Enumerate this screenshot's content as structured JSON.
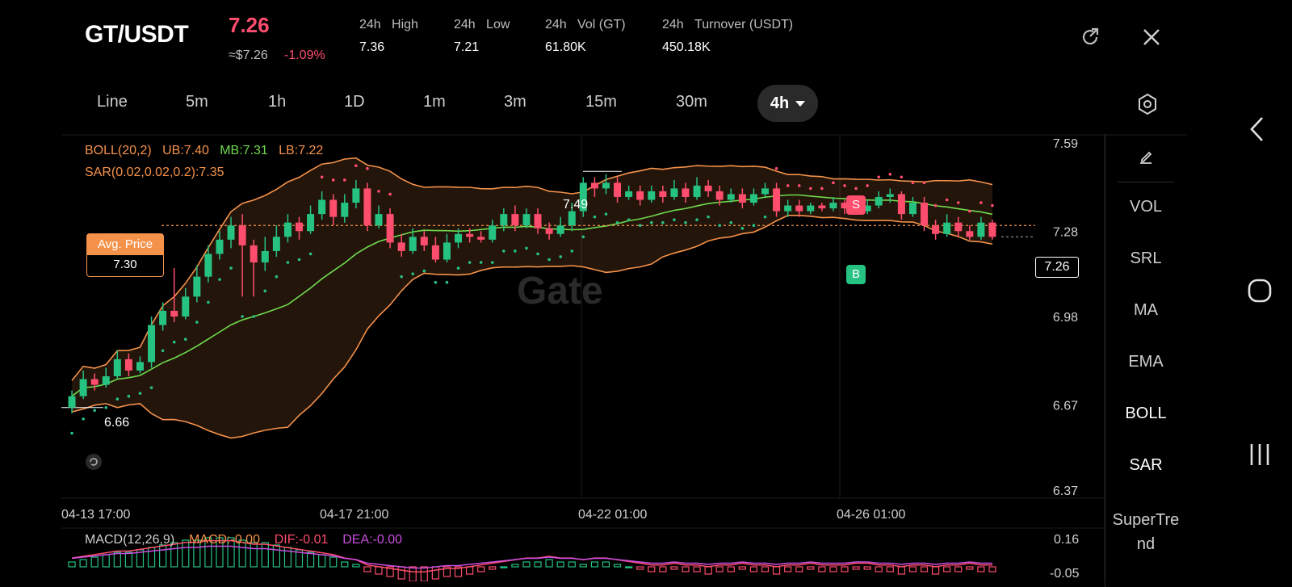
{
  "header": {
    "pair": "GT/USDT",
    "price": "7.26",
    "approx": "≈$7.26",
    "change": "-1.09%",
    "stats": [
      {
        "period": "24h",
        "label": "High",
        "value": "7.36"
      },
      {
        "period": "24h",
        "label": "Low",
        "value": "7.21"
      },
      {
        "period": "24h",
        "label": "Vol (GT)",
        "value": "61.80K"
      },
      {
        "period": "24h",
        "label": "Turnover (USDT)",
        "value": "450.18K"
      }
    ],
    "icons": [
      "share-icon",
      "close-icon"
    ]
  },
  "timeframes": [
    "Line",
    "5m",
    "1h",
    "1D",
    "1m",
    "3m",
    "15m",
    "30m"
  ],
  "active_timeframe": "4h",
  "settings_icon": "settings-hex-icon",
  "legend": {
    "boll_name": "BOLL(20,2)",
    "boll_ub": "UB:7.40",
    "boll_mb": "MB:7.31",
    "boll_lb": "LB:7.22",
    "sar": "SAR(0.02,0.02,0.2):7.35"
  },
  "avg_price": {
    "label": "Avg. Price",
    "value": "7.30"
  },
  "markers": {
    "sell": "S",
    "buy": "B",
    "high_label": "7.49",
    "low_label": "6.66",
    "last_price": "7.26",
    "hidden_axis_label": "7.28"
  },
  "watermark": "Gate",
  "side_panel": {
    "edit_icon": "pencil-icon",
    "items": [
      "VOL",
      "SRL",
      "MA",
      "EMA",
      "BOLL",
      "SAR",
      "SuperTre",
      "nd"
    ]
  },
  "nav_icons": [
    "back-icon",
    "home-icon",
    "recents-icon"
  ],
  "macd": {
    "name": "MACD(12,26,9)",
    "macd": "MACD:-0.00",
    "dif": "DIF:-0.01",
    "dea": "DEA:-0.00",
    "axis_top": "0.16",
    "axis_bottom": "-0.05"
  },
  "colors": {
    "up": "#26c281",
    "down": "#ff4d6d",
    "boll_band": "#f5924a",
    "mb": "#6fdb4e",
    "sar": "#ff4d6d",
    "dif": "#ff4d6d",
    "dea": "#c94fe0"
  },
  "chart_data": {
    "type": "candlestick",
    "y_ticks": [
      "7.59",
      "6.98",
      "6.67",
      "6.37"
    ],
    "x_ticks": [
      "04-13 17:00",
      "04-17 21:00",
      "04-22 01:00",
      "04-26 01:00"
    ],
    "ylim": [
      6.37,
      7.59
    ],
    "avg_price": 7.3,
    "grid": true,
    "candles": [
      [
        6.66,
        6.7,
        6.64,
        6.72
      ],
      [
        6.7,
        6.76,
        6.69,
        6.79
      ],
      [
        6.76,
        6.74,
        6.72,
        6.78
      ],
      [
        6.74,
        6.77,
        6.73,
        6.8
      ],
      [
        6.77,
        6.83,
        6.76,
        6.86
      ],
      [
        6.83,
        6.79,
        6.77,
        6.85
      ],
      [
        6.79,
        6.82,
        6.78,
        6.84
      ],
      [
        6.82,
        6.95,
        6.8,
        6.98
      ],
      [
        6.95,
        7.0,
        6.93,
        7.03
      ],
      [
        7.0,
        6.98,
        6.96,
        7.15
      ],
      [
        6.98,
        7.05,
        6.97,
        7.08
      ],
      [
        7.05,
        7.12,
        7.03,
        7.16
      ],
      [
        7.12,
        7.2,
        7.1,
        7.23
      ],
      [
        7.2,
        7.25,
        7.18,
        7.28
      ],
      [
        7.25,
        7.3,
        7.22,
        7.33
      ],
      [
        7.3,
        7.23,
        7.05,
        7.34
      ],
      [
        7.23,
        7.17,
        7.05,
        7.25
      ],
      [
        7.17,
        7.21,
        7.14,
        7.26
      ],
      [
        7.21,
        7.26,
        7.19,
        7.3
      ],
      [
        7.26,
        7.31,
        7.24,
        7.34
      ],
      [
        7.31,
        7.28,
        7.25,
        7.33
      ],
      [
        7.28,
        7.34,
        7.27,
        7.37
      ],
      [
        7.34,
        7.39,
        7.32,
        7.42
      ],
      [
        7.39,
        7.33,
        7.3,
        7.41
      ],
      [
        7.33,
        7.38,
        7.31,
        7.41
      ],
      [
        7.38,
        7.43,
        7.36,
        7.46
      ],
      [
        7.43,
        7.3,
        7.28,
        7.45
      ],
      [
        7.3,
        7.34,
        7.29,
        7.37
      ],
      [
        7.34,
        7.24,
        7.22,
        7.36
      ],
      [
        7.24,
        7.21,
        7.19,
        7.27
      ],
      [
        7.21,
        7.26,
        7.2,
        7.29
      ],
      [
        7.26,
        7.23,
        7.21,
        7.28
      ],
      [
        7.23,
        7.18,
        7.17,
        7.26
      ],
      [
        7.18,
        7.24,
        7.17,
        7.27
      ],
      [
        7.24,
        7.27,
        7.22,
        7.29
      ],
      [
        7.27,
        7.26,
        7.24,
        7.29
      ],
      [
        7.26,
        7.25,
        7.24,
        7.28
      ],
      [
        7.25,
        7.3,
        7.24,
        7.32
      ],
      [
        7.3,
        7.34,
        7.28,
        7.36
      ],
      [
        7.34,
        7.3,
        7.28,
        7.37
      ],
      [
        7.3,
        7.34,
        7.29,
        7.36
      ],
      [
        7.34,
        7.29,
        7.27,
        7.36
      ],
      [
        7.29,
        7.27,
        7.25,
        7.31
      ],
      [
        7.27,
        7.3,
        7.26,
        7.33
      ],
      [
        7.3,
        7.35,
        7.28,
        7.38
      ],
      [
        7.35,
        7.45,
        7.33,
        7.47
      ],
      [
        7.45,
        7.43,
        7.4,
        7.47
      ],
      [
        7.43,
        7.45,
        7.41,
        7.48
      ],
      [
        7.45,
        7.4,
        7.38,
        7.47
      ],
      [
        7.4,
        7.42,
        7.39,
        7.44
      ],
      [
        7.42,
        7.39,
        7.37,
        7.44
      ],
      [
        7.39,
        7.42,
        7.38,
        7.44
      ],
      [
        7.42,
        7.4,
        7.38,
        7.44
      ],
      [
        7.4,
        7.43,
        7.39,
        7.46
      ],
      [
        7.43,
        7.4,
        7.38,
        7.45
      ],
      [
        7.4,
        7.44,
        7.39,
        7.47
      ],
      [
        7.44,
        7.42,
        7.4,
        7.46
      ],
      [
        7.42,
        7.39,
        7.37,
        7.44
      ],
      [
        7.39,
        7.41,
        7.38,
        7.43
      ],
      [
        7.41,
        7.38,
        7.36,
        7.43
      ],
      [
        7.38,
        7.41,
        7.37,
        7.43
      ],
      [
        7.41,
        7.43,
        7.4,
        7.45
      ],
      [
        7.43,
        7.35,
        7.33,
        7.45
      ],
      [
        7.35,
        7.37,
        7.33,
        7.39
      ],
      [
        7.37,
        7.35,
        7.33,
        7.39
      ],
      [
        7.35,
        7.37,
        7.34,
        7.38
      ],
      [
        7.37,
        7.36,
        7.35,
        7.38
      ],
      [
        7.36,
        7.38,
        7.35,
        7.4
      ],
      [
        7.38,
        7.36,
        7.34,
        7.39
      ],
      [
        7.36,
        7.35,
        7.34,
        7.38
      ],
      [
        7.35,
        7.37,
        7.34,
        7.39
      ],
      [
        7.37,
        7.4,
        7.36,
        7.42
      ],
      [
        7.4,
        7.41,
        7.38,
        7.43
      ],
      [
        7.41,
        7.34,
        7.32,
        7.42
      ],
      [
        7.34,
        7.38,
        7.33,
        7.4
      ],
      [
        7.38,
        7.3,
        7.28,
        7.4
      ],
      [
        7.3,
        7.27,
        7.25,
        7.32
      ],
      [
        7.27,
        7.31,
        7.26,
        7.34
      ],
      [
        7.31,
        7.28,
        7.26,
        7.33
      ],
      [
        7.28,
        7.26,
        7.25,
        7.3
      ],
      [
        7.26,
        7.31,
        7.25,
        7.33
      ],
      [
        7.31,
        7.26,
        7.25,
        7.32
      ]
    ],
    "macd_hist": [
      0.01,
      0.015,
      0.02,
      0.025,
      0.03,
      0.03,
      0.035,
      0.04,
      0.045,
      0.05,
      0.055,
      0.055,
      0.06,
      0.06,
      0.06,
      0.055,
      0.05,
      0.05,
      0.045,
      0.04,
      0.035,
      0.03,
      0.025,
      0.02,
      0.01,
      0.005,
      -0.01,
      -0.015,
      -0.02,
      -0.025,
      -0.03,
      -0.03,
      -0.025,
      -0.02,
      -0.02,
      -0.015,
      -0.01,
      -0.005,
      0.0,
      0.005,
      0.01,
      0.01,
      0.015,
      0.01,
      0.01,
      0.005,
      0.01,
      0.01,
      0.005,
      0.0,
      -0.005,
      -0.01,
      -0.01,
      -0.005,
      -0.01,
      -0.01,
      -0.015,
      -0.01,
      -0.01,
      -0.005,
      -0.01,
      -0.01,
      -0.015,
      -0.01,
      -0.01,
      -0.005,
      -0.01,
      -0.01,
      -0.01,
      -0.005,
      -0.005,
      -0.01,
      -0.01,
      -0.015,
      -0.01,
      -0.01,
      -0.015,
      -0.01,
      -0.01,
      -0.005,
      -0.01,
      -0.01
    ]
  }
}
